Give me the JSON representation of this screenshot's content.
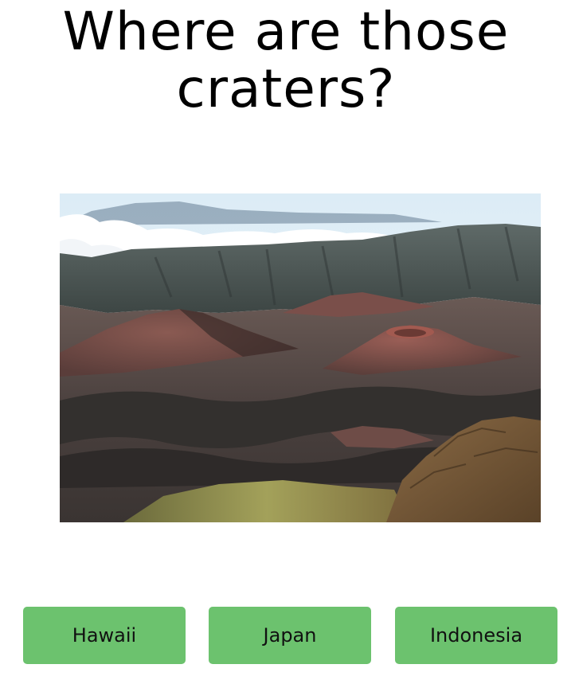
{
  "question": {
    "line1": "Where are those",
    "line2": "craters?"
  },
  "image": {
    "subject": "volcanic-craters-landscape"
  },
  "answers": [
    {
      "label": "Hawaii"
    },
    {
      "label": "Japan"
    },
    {
      "label": "Indonesia"
    }
  ],
  "colors": {
    "button": "#6cc26e",
    "background": "#ffffff",
    "text": "#000000"
  }
}
